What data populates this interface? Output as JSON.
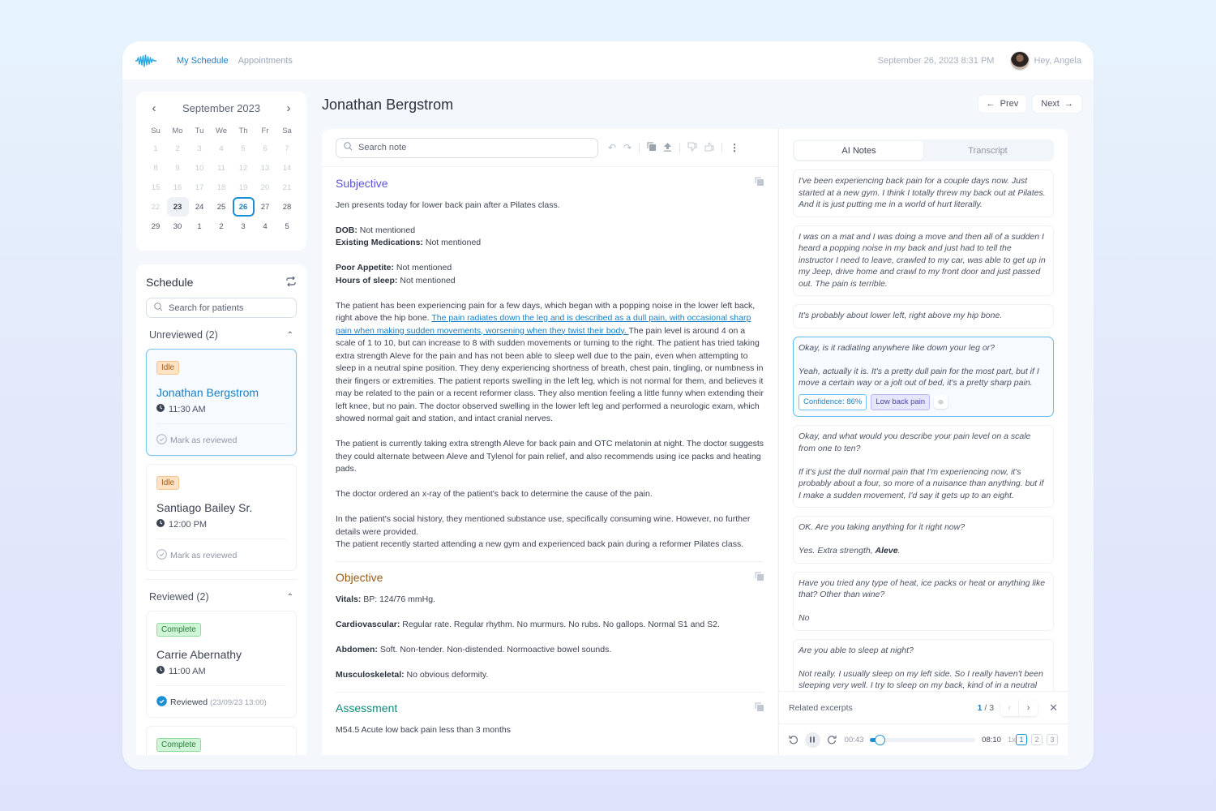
{
  "topbar": {
    "nav": [
      {
        "label": "My Schedule",
        "active": true
      },
      {
        "label": "Appointments",
        "active": false
      }
    ],
    "datetime": "September 26, 2023 8:31 PM",
    "greeting": "Hey, Angela",
    "brand_color": "#1a8fd6"
  },
  "calendar": {
    "month_label": "September 2023",
    "weekdays": [
      "Su",
      "Mo",
      "Tu",
      "We",
      "Th",
      "Fr",
      "Sa"
    ],
    "weeks": [
      [
        "1",
        "2",
        "3",
        "4",
        "5",
        "6",
        "7"
      ],
      [
        "8",
        "9",
        "10",
        "11",
        "12",
        "13",
        "14"
      ],
      [
        "15",
        "16",
        "17",
        "18",
        "19",
        "20",
        "21"
      ],
      [
        "22",
        "23",
        "24",
        "25",
        "26",
        "27",
        "28"
      ],
      [
        "29",
        "30",
        "1",
        "2",
        "3",
        "4",
        "5"
      ]
    ],
    "selected_day": "23",
    "today": "26"
  },
  "schedule": {
    "title": "Schedule",
    "search_placeholder": "Search for patients",
    "unreviewed": {
      "label": "Unreviewed (2)",
      "patients": [
        {
          "status": "Idle",
          "name": "Jonathan Bergstrom",
          "time": "11:30 AM",
          "action": "Mark as reviewed"
        },
        {
          "status": "Idle",
          "name": "Santiago Bailey Sr.",
          "time": "12:00 PM",
          "action": "Mark as reviewed"
        }
      ]
    },
    "reviewed": {
      "label": "Reviewed (2)",
      "patients": [
        {
          "status": "Complete",
          "name": "Carrie Abernathy",
          "time": "11:00 AM",
          "action": "Reviewed",
          "reviewed_at": "(23/09/23 13:00)"
        },
        {
          "status": "Complete"
        }
      ]
    }
  },
  "patient": {
    "name": "Jonathan Bergstrom",
    "prev_label": "Prev",
    "next_label": "Next"
  },
  "note": {
    "search_placeholder": "Search note",
    "subjective": {
      "title": "Subjective",
      "intro": "Jen presents today for lower back pain after a Pilates class.",
      "fields1": [
        {
          "label": "DOB:",
          "value": " Not mentioned"
        },
        {
          "label": "Existing Medications:",
          "value": " Not mentioned"
        }
      ],
      "fields2": [
        {
          "label": "Poor Appetite:",
          "value": " Not mentioned"
        },
        {
          "label": "Hours of sleep:",
          "value": " Not mentioned"
        }
      ],
      "para1_a": "The patient has been experiencing pain for a few days, which began with a popping noise in the lower left back, right above the hip bone. ",
      "para1_highlight": "The pain radiates down the leg and is described as a dull pain, with occasional sharp pain when making sudden movements, worsening when they twist their body. ",
      "para1_b": "The pain level is around 4 on a scale of 1 to 10, but can increase to 8 with sudden movements or turning to the right. The patient has tried taking extra strength Aleve for the pain and has not been able to sleep well due to the pain, even when attempting to sleep in a neutral spine position. They deny experiencing shortness of breath, chest pain, tingling, or numbness in their fingers or extremities. The patient reports swelling in the left leg, which is not normal for them, and believes it may be related to the pain or a recent reformer class. They also mention feeling a little funny when extending their left knee, but no pain. The doctor observed swelling in the lower left leg and performed a neurologic exam, which showed normal gait and station, and intact cranial nerves.",
      "para2": "The patient is currently taking extra strength Aleve for back pain and OTC melatonin at night. The doctor suggests they could alternate between Aleve and Tylenol for pain relief, and also recommends using ice packs and heating pads.",
      "para3": "The doctor ordered an x-ray of the patient's back to determine the cause of the pain.",
      "para4": "In the patient's social history, they mentioned substance use, specifically consuming wine. However, no further details were provided.",
      "para5": "The patient recently started attending a new gym and experienced back pain during a reformer Pilates class."
    },
    "objective": {
      "title": "Objective",
      "fields": [
        {
          "label": "Vitals:",
          "value": " BP: 124/76 mmHg."
        },
        {
          "label": "Cardiovascular:",
          "value": " Regular rate. Regular rhythm. No murmurs. No rubs. No gallops. Normal S1 and S2."
        },
        {
          "label": "Abdomen:",
          "value": " Soft. Non-tender. Non-distended. Normoactive bowel sounds."
        },
        {
          "label": "Musculoskeletal:",
          "value": " No  obvious deformity."
        }
      ]
    },
    "assessment": {
      "title": "Assessment",
      "first_line": "M54.5 Acute low back pain less than 3 months"
    },
    "section_colors": {
      "subjective": "#5a55d6",
      "objective": "#9a5a12",
      "assessment": "#0f8a7a"
    }
  },
  "transcript_panel": {
    "tabs": [
      {
        "label": "AI Notes",
        "active": true
      },
      {
        "label": "Transcript",
        "active": false
      }
    ],
    "excerpts": [
      {
        "lines": [
          "I've been experiencing back pain for a couple days now. Just started at a new gym. I think I totally threw my back out at Pilates. And it is just putting me in a world of hurt literally."
        ]
      },
      {
        "lines": [
          "I was on a mat and I was doing a move and then all of a sudden I heard a popping noise in my back and just had to tell the instructor I need to leave, crawled to my car, was able to get up in my Jeep, drive home and crawl to my front door and just passed out. The pain is terrible."
        ]
      },
      {
        "lines": [
          "It's probably about lower left, right above my hip bone."
        ]
      },
      {
        "lines": [
          "Okay, is it radiating anywhere like down your leg or?",
          "Yeah, actually it is. It's a pretty dull pain for the most part, but if I move a certain way or a jolt out of bed, it's a pretty sharp pain."
        ],
        "active": true,
        "confidence": "Confidence: 86%",
        "topic": "Low back pain"
      },
      {
        "lines": [
          "Okay, and what would you describe your pain level on a scale from one to ten?",
          "If it's just the dull normal pain that I'm experiencing now, it's probably about a four, so more of a nuisance than anything. but if I make a sudden movement, I'd say it gets up to an eight."
        ]
      },
      {
        "lines": [
          "OK. Are you taking anything for it right now?"
        ],
        "answer_prefix": " Yes. Extra strength, ",
        "answer_bold": "Aleve",
        "answer_suffix": "."
      },
      {
        "lines": [
          "Have you tried any type of heat, ice packs or heat or anything like that? Other than wine?",
          "No"
        ]
      },
      {
        "lines": [
          "Are you able to sleep at night?",
          "Not really. I usually sleep on my left side. So I really haven't been sleeping very well. I try to sleep on my back, kind of in a neutral"
        ]
      }
    ],
    "related": {
      "label": "Related excerpts",
      "current": "1",
      "total": " / 3"
    },
    "player": {
      "elapsed": "00:43",
      "duration": "08:10",
      "progress_fraction": 0.088,
      "speed": "1x",
      "channels": [
        "1",
        "2",
        "3"
      ],
      "active_channel": "1"
    }
  }
}
